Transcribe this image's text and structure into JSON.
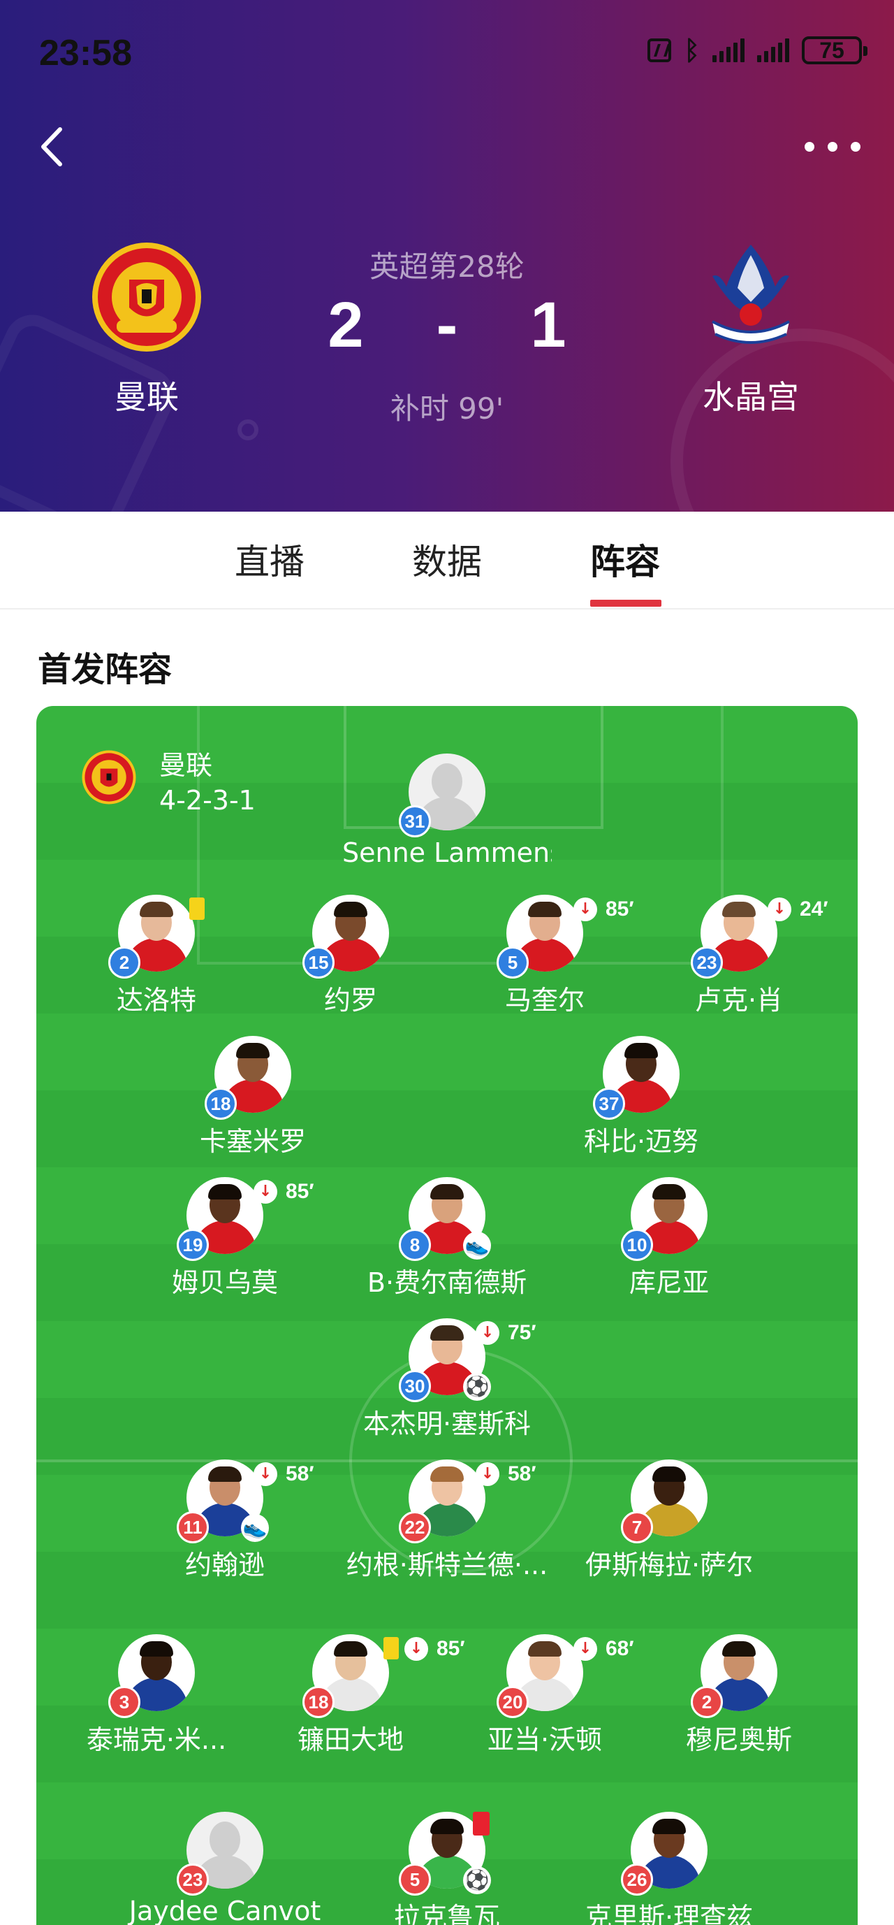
{
  "status_bar": {
    "time": "23:58",
    "battery": "75"
  },
  "match": {
    "competition": "英超第28轮",
    "home_team": "曼联",
    "away_team": "水晶宫",
    "home_score": "2",
    "separator": "-",
    "away_score": "1",
    "time": "补时 99'"
  },
  "tabs": {
    "live": "直播",
    "stats": "数据",
    "lineup": "阵容"
  },
  "section_title": "首发阵容",
  "home": {
    "name": "曼联",
    "formation": "4-2-3-1"
  },
  "players": [
    {
      "name": "Senne Lammens",
      "number": "31",
      "sub_minute": ""
    },
    {
      "name": "达洛特",
      "number": "2",
      "sub_minute": ""
    },
    {
      "name": "约罗",
      "number": "15",
      "sub_minute": ""
    },
    {
      "name": "马奎尔",
      "number": "5",
      "sub_minute": "85′"
    },
    {
      "name": "卢克·肖",
      "number": "23",
      "sub_minute": "24′"
    },
    {
      "name": "卡塞米罗",
      "number": "18",
      "sub_minute": ""
    },
    {
      "name": "科比·迈努",
      "number": "37",
      "sub_minute": ""
    },
    {
      "name": "姆贝乌莫",
      "number": "19",
      "sub_minute": "85′"
    },
    {
      "name": "B·费尔南德斯",
      "number": "8",
      "sub_minute": ""
    },
    {
      "name": "库尼亚",
      "number": "10",
      "sub_minute": ""
    },
    {
      "name": "本杰明·塞斯科",
      "number": "30",
      "sub_minute": "75′"
    },
    {
      "name": "约翰逊",
      "number": "11",
      "sub_minute": "58′"
    },
    {
      "name": "约根·斯特兰德·...",
      "number": "22",
      "sub_minute": "58′"
    },
    {
      "name": "伊斯梅拉·萨尔",
      "number": "7",
      "sub_minute": ""
    },
    {
      "name": "泰瑞克·米...",
      "number": "3",
      "sub_minute": ""
    },
    {
      "name": "镰田大地",
      "number": "18",
      "sub_minute": "85′"
    },
    {
      "name": "亚当·沃顿",
      "number": "20",
      "sub_minute": "68′"
    },
    {
      "name": "穆尼奥斯",
      "number": "2",
      "sub_minute": ""
    },
    {
      "name": "Jaydee Canvot",
      "number": "23",
      "sub_minute": ""
    },
    {
      "name": "拉克鲁瓦",
      "number": "5",
      "sub_minute": ""
    },
    {
      "name": "克里斯·理查兹",
      "number": "26",
      "sub_minute": ""
    }
  ],
  "colors": {
    "accent": "#e0343f",
    "home_number": "#2f7fe0",
    "away_number": "#e84545",
    "pitch": "#37b43f"
  }
}
